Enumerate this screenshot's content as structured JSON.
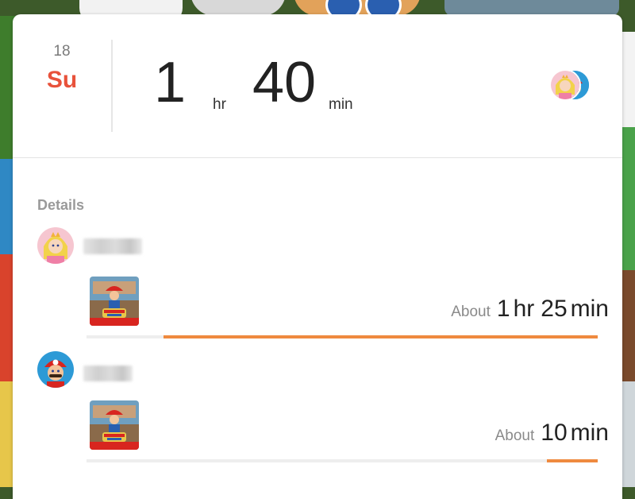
{
  "header": {
    "day_number": "18",
    "day_name": "Su",
    "total_hours": "1",
    "hours_unit": "hr",
    "total_minutes": "40",
    "minutes_unit": "min"
  },
  "details": {
    "label": "Details",
    "players": [
      {
        "avatar_icon": "peach-avatar-icon",
        "game_icon": "mario-odyssey-game-icon",
        "about_label": "About",
        "hours": "1",
        "hours_unit": "hr",
        "minutes": "25",
        "minutes_unit": "min",
        "share_percent": 85
      },
      {
        "avatar_icon": "mario-avatar-icon",
        "game_icon": "mario-odyssey-game-icon",
        "about_label": "About",
        "minutes": "10",
        "minutes_unit": "min",
        "share_percent": 10
      }
    ]
  },
  "colors": {
    "accent_day": "#e8523b",
    "bar_fill": "#ef8a3f",
    "bar_track": "#eeeeee"
  }
}
